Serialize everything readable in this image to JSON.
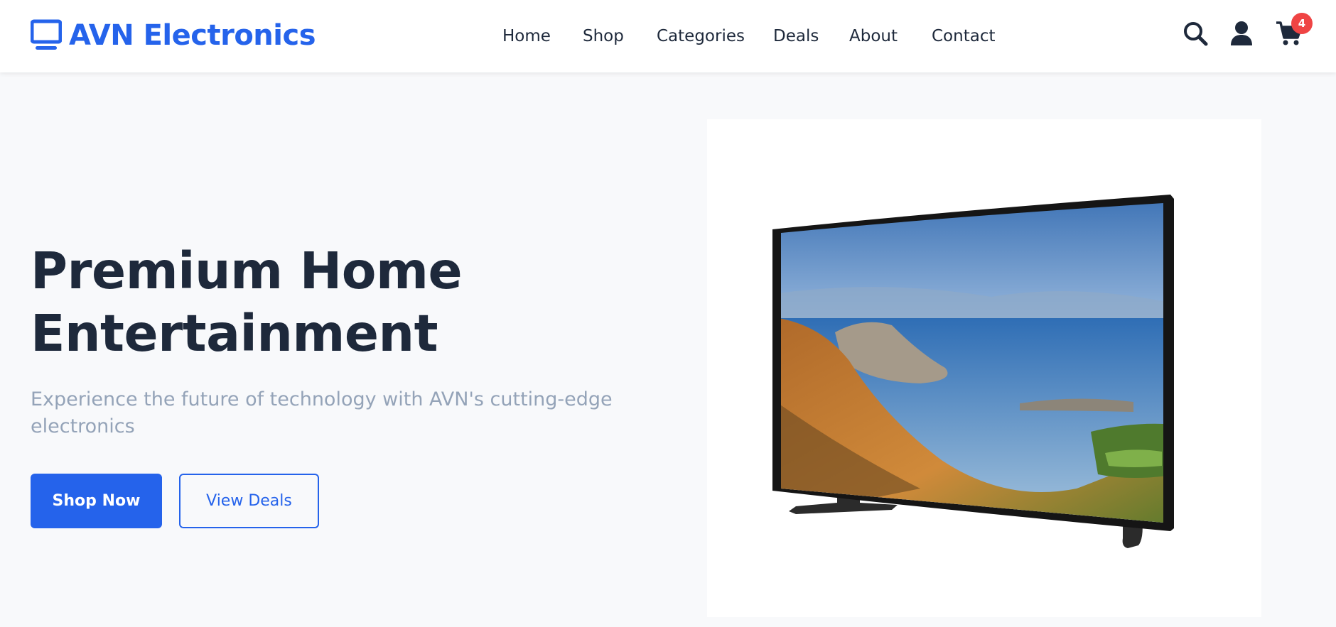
{
  "brand": {
    "name": "AVN Electronics",
    "icon": "monitor-icon",
    "color": "#2563eb"
  },
  "nav": {
    "items": [
      {
        "label": "Home"
      },
      {
        "label": "Shop"
      },
      {
        "label": "Categories"
      },
      {
        "label": "Deals"
      },
      {
        "label": "About"
      },
      {
        "label": "Contact"
      }
    ]
  },
  "header_icons": {
    "search": "search-icon",
    "account": "user-icon",
    "cart": "cart-icon",
    "cart_count": "4",
    "badge_color": "#ef4444"
  },
  "hero": {
    "title_line1": "Premium Home",
    "title_line2": "Entertainment",
    "subtitle_line1": "Experience the future of technology with AVN's cutting-edge",
    "subtitle_line2": "electronics",
    "primary_button": "Shop Now",
    "secondary_button": "View Deals",
    "image": "curved-tv-image"
  },
  "colors": {
    "accent": "#2563eb",
    "heading": "#1e293b",
    "muted": "#94a3b8",
    "background": "#f8f9fb"
  }
}
